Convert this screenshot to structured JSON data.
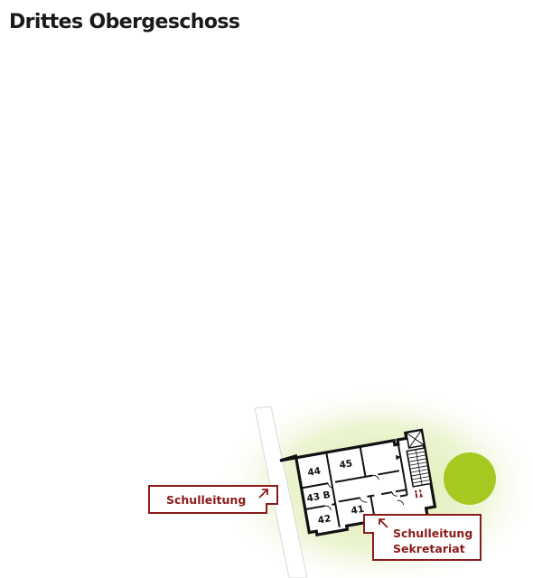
{
  "title": "Drittes Obergeschoss",
  "rooms": [
    {
      "id": "44",
      "label": "44"
    },
    {
      "id": "45",
      "label": "45"
    },
    {
      "id": "43b",
      "label": "43 B"
    },
    {
      "id": "42",
      "label": "42"
    },
    {
      "id": "41",
      "label": "41"
    }
  ],
  "callouts": {
    "left": {
      "line1": "Schulleitung"
    },
    "right": {
      "line1": "Schulleitung",
      "line2": "Sekretariat"
    }
  },
  "colors": {
    "accent": "#8b1a1a",
    "lawn": "#e8f2c8",
    "tree": "#a6c922",
    "wall": "#111111"
  },
  "icons": {
    "elevator": "elevator-icon",
    "stairs": "stairs-icon",
    "restroom": "restroom-icon",
    "tree": "tree-icon",
    "arrow": "arrow-diagonal-icon"
  }
}
